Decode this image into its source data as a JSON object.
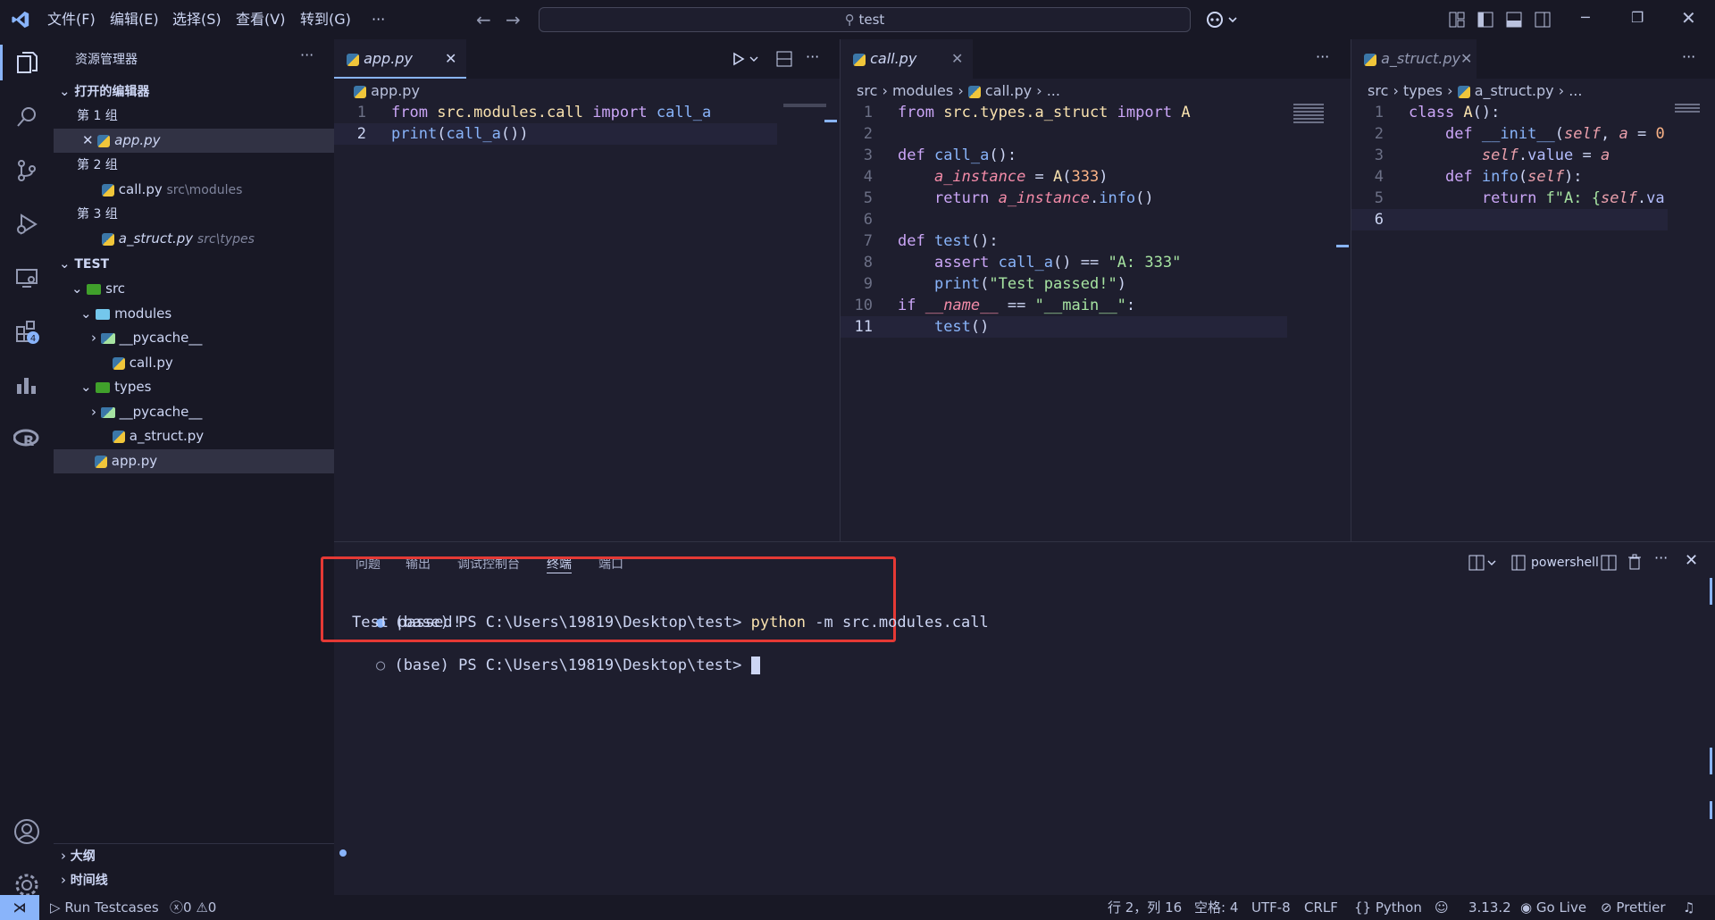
{
  "titlebar": {
    "menus": [
      "文件(F)",
      "编辑(E)",
      "选择(S)",
      "查看(V)",
      "转到(G)",
      "···"
    ],
    "search": "test"
  },
  "sidebar": {
    "title": "资源管理器",
    "open_editors": "打开的编辑器",
    "groups": [
      {
        "label": "第 1 组",
        "file": "app.py",
        "path": ""
      },
      {
        "label": "第 2 组",
        "file": "call.py",
        "path": "src\\modules"
      },
      {
        "label": "第 3 组",
        "file": "a_struct.py",
        "path": "src\\types"
      }
    ],
    "project": "TEST",
    "tree": [
      "src",
      "modules",
      "__pycache__",
      "call.py",
      "types",
      "__pycache__",
      "a_struct.py",
      "app.py"
    ],
    "outline": "大纲",
    "timeline": "时间线"
  },
  "editor1": {
    "tab": "app.py",
    "crumb": "app.py",
    "lines": [
      {
        "n": "1",
        "parts": [
          [
            "kw",
            "from "
          ],
          [
            "mod",
            "src.modules.call "
          ],
          [
            "kw",
            "import "
          ],
          [
            "fn",
            "call_a"
          ]
        ]
      },
      {
        "n": "2",
        "parts": [
          [
            "fn",
            "print"
          ],
          [
            "p",
            "("
          ],
          [
            "fn",
            "call_a"
          ],
          [
            "p",
            "())"
          ]
        ]
      }
    ]
  },
  "editor2": {
    "tab": "call.py",
    "crumb": [
      "src",
      "modules",
      "call.py",
      "..."
    ],
    "lines": [
      {
        "n": "1",
        "parts": [
          [
            "kw",
            "from "
          ],
          [
            "mod",
            "src.types.a_struct "
          ],
          [
            "kw",
            "import "
          ],
          [
            "cls",
            "A"
          ]
        ]
      },
      {
        "n": "2",
        "parts": []
      },
      {
        "n": "3",
        "parts": [
          [
            "kw",
            "def "
          ],
          [
            "fn",
            "call_a"
          ],
          [
            "p",
            "():"
          ]
        ]
      },
      {
        "n": "4",
        "parts": [
          [
            "p",
            "    "
          ],
          [
            "var",
            "a_instance"
          ],
          [
            "p",
            " = "
          ],
          [
            "cls",
            "A"
          ],
          [
            "p",
            "("
          ],
          [
            "num",
            "333"
          ],
          [
            "p",
            ")"
          ]
        ]
      },
      {
        "n": "5",
        "parts": [
          [
            "p",
            "    "
          ],
          [
            "kw",
            "return "
          ],
          [
            "var",
            "a_instance"
          ],
          [
            "p",
            "."
          ],
          [
            "fn",
            "info"
          ],
          [
            "p",
            "()"
          ]
        ]
      },
      {
        "n": "6",
        "parts": []
      },
      {
        "n": "7",
        "parts": [
          [
            "kw",
            "def "
          ],
          [
            "fn",
            "test"
          ],
          [
            "p",
            "():"
          ]
        ]
      },
      {
        "n": "8",
        "parts": [
          [
            "p",
            "    "
          ],
          [
            "kw",
            "assert "
          ],
          [
            "fn",
            "call_a"
          ],
          [
            "p",
            "() == "
          ],
          [
            "str",
            "\"A: 333\""
          ]
        ]
      },
      {
        "n": "9",
        "parts": [
          [
            "p",
            "    "
          ],
          [
            "fn",
            "print"
          ],
          [
            "p",
            "("
          ],
          [
            "str",
            "\"Test passed!\""
          ],
          [
            "p",
            ")"
          ]
        ]
      },
      {
        "n": "10",
        "parts": [
          [
            "kw",
            "if "
          ],
          [
            "var",
            "__name__"
          ],
          [
            "p",
            " == "
          ],
          [
            "str",
            "\"__main__\""
          ],
          [
            "p",
            ":"
          ]
        ]
      },
      {
        "n": "11",
        "parts": [
          [
            "p",
            "    "
          ],
          [
            "fn",
            "test"
          ],
          [
            "p",
            "()"
          ]
        ]
      }
    ]
  },
  "editor3": {
    "tab": "a_struct.py",
    "crumb": [
      "src",
      "types",
      "a_struct.py",
      "..."
    ],
    "lines": [
      {
        "n": "1",
        "parts": [
          [
            "kw",
            "class "
          ],
          [
            "cls",
            "A"
          ],
          [
            "p",
            "():"
          ]
        ]
      },
      {
        "n": "2",
        "parts": [
          [
            "p",
            "    "
          ],
          [
            "kw",
            "def "
          ],
          [
            "fn",
            "__init__"
          ],
          [
            "p",
            "("
          ],
          [
            "param",
            "self"
          ],
          [
            "p",
            ", "
          ],
          [
            "param",
            "a"
          ],
          [
            "p",
            " = "
          ],
          [
            "num",
            "0"
          ]
        ]
      },
      {
        "n": "3",
        "parts": [
          [
            "p",
            "        "
          ],
          [
            "param",
            "self"
          ],
          [
            "p",
            "."
          ],
          [
            "prop",
            "value"
          ],
          [
            "p",
            " = "
          ],
          [
            "param",
            "a"
          ]
        ]
      },
      {
        "n": "4",
        "parts": [
          [
            "p",
            "    "
          ],
          [
            "kw",
            "def "
          ],
          [
            "fn",
            "info"
          ],
          [
            "p",
            "("
          ],
          [
            "param",
            "self"
          ],
          [
            "p",
            "):"
          ]
        ]
      },
      {
        "n": "5",
        "parts": [
          [
            "p",
            "        "
          ],
          [
            "kw",
            "return "
          ],
          [
            "str",
            "f\"A: {"
          ],
          [
            "param",
            "self"
          ],
          [
            "p",
            "."
          ],
          [
            "prop",
            "va"
          ]
        ]
      },
      {
        "n": "6",
        "parts": []
      }
    ]
  },
  "panel": {
    "tabs": [
      "问题",
      "输出",
      "调试控制台",
      "终端",
      "端口"
    ],
    "shell": "powershell",
    "term_prompt": "(base) PS C:\\Users\\19819\\Desktop\\test> ",
    "term_cmd1": "python",
    "term_cmd2": " -m src.modules.call",
    "term_out": "Test passed!",
    "term_prompt2": "(base) PS C:\\Users\\19819\\Desktop\\test> "
  },
  "status": {
    "run": "Run Testcases",
    "errors": "0",
    "warnings": "0",
    "position": "行 2，列 16",
    "spaces": "空格: 4",
    "encoding": "UTF-8",
    "eol": "CRLF",
    "lang": "Python",
    "version": "3.13.2",
    "golive": "Go Live",
    "prettier": "Prettier"
  },
  "colors": {
    "accent": "#89b4fa",
    "highlight_box": "#e53935",
    "extensions_badge": "4"
  }
}
